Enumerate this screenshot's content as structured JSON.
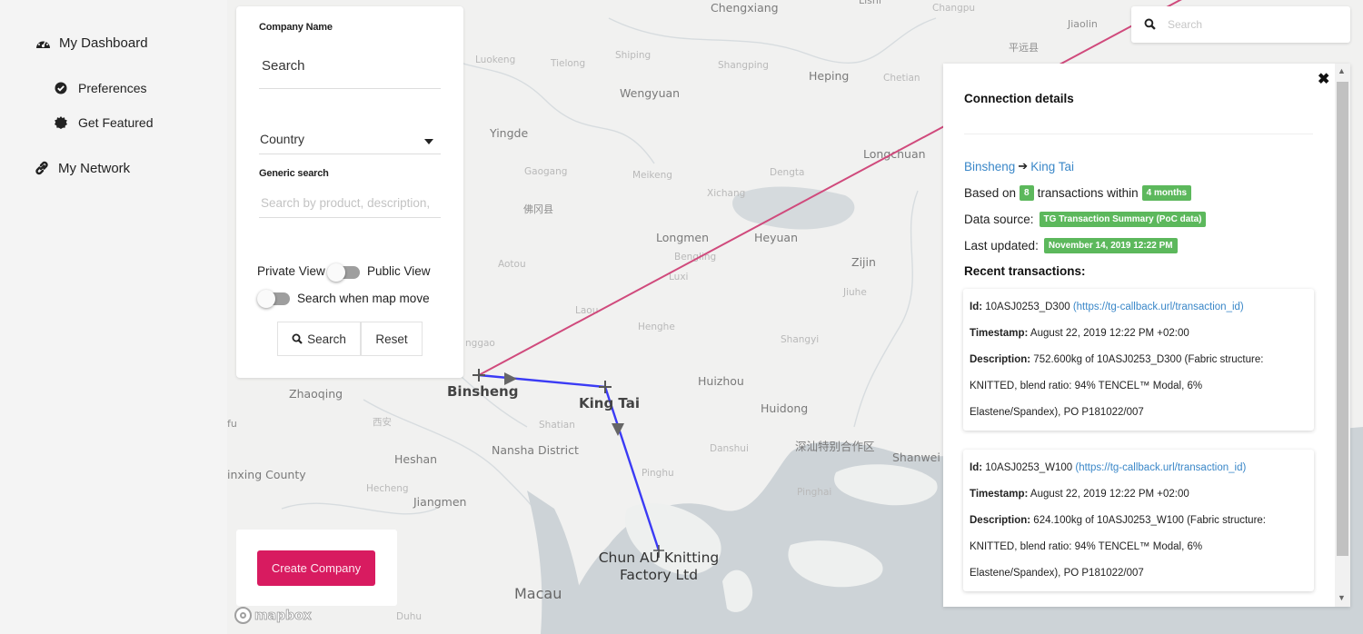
{
  "sidebar": {
    "items": [
      {
        "label": "My Dashboard",
        "icon": "dashboard-icon"
      },
      {
        "label": "Preferences",
        "icon": "check-circle-icon"
      },
      {
        "label": "Get Featured",
        "icon": "certificate-icon"
      },
      {
        "label": "My Network",
        "icon": "link-icon"
      }
    ]
  },
  "search_panel": {
    "company_name_label": "Company Name",
    "company_name_value": "Search",
    "country_value": "Country",
    "generic_search_label": "Generic search",
    "generic_search_placeholder": "Search by product, description,",
    "private_view_label": "Private View",
    "public_view_label": "Public View",
    "search_when_map_move_label": "Search when map move",
    "search_button": "Search",
    "reset_button": "Reset"
  },
  "create_company_button": "Create Company",
  "map": {
    "search_placeholder": "Search",
    "attribution": "mapbox",
    "colors": {
      "route_pink": "#d04a7c",
      "route_blue": "#3b3bf5",
      "water": "#cfd4d8"
    },
    "places": [
      {
        "name": "Chengxiang",
        "cls": "big"
      },
      {
        "name": "Lishi",
        "cls": ""
      },
      {
        "name": "Changpu",
        "cls": "faint"
      },
      {
        "name": "Jiaolin",
        "cls": ""
      },
      {
        "name": "平远县",
        "cls": ""
      },
      {
        "name": "Luokeng",
        "cls": "faint"
      },
      {
        "name": "Tielong",
        "cls": "faint"
      },
      {
        "name": "Shiping",
        "cls": "faint"
      },
      {
        "name": "Shangping",
        "cls": "faint"
      },
      {
        "name": "Heping",
        "cls": "big"
      },
      {
        "name": "Chetian",
        "cls": "faint"
      },
      {
        "name": "Wengyuan",
        "cls": "big"
      },
      {
        "name": "Yingde",
        "cls": "big"
      },
      {
        "name": "Longchuan",
        "cls": "big"
      },
      {
        "name": "Gaogang",
        "cls": "faint"
      },
      {
        "name": "Meikeng",
        "cls": "faint"
      },
      {
        "name": "Dengta",
        "cls": "faint"
      },
      {
        "name": "Xichang",
        "cls": "faint"
      },
      {
        "name": "佛冈县",
        "cls": ""
      },
      {
        "name": "Longmen",
        "cls": "big"
      },
      {
        "name": "Heyuan",
        "cls": "big"
      },
      {
        "name": "Bengling",
        "cls": "faint"
      },
      {
        "name": "Aotou",
        "cls": "faint"
      },
      {
        "name": "Zijin",
        "cls": "big"
      },
      {
        "name": "Luxi",
        "cls": "faint"
      },
      {
        "name": "Jiuhe",
        "cls": "faint"
      },
      {
        "name": "Laou",
        "cls": "faint"
      },
      {
        "name": "Henghe",
        "cls": "faint"
      },
      {
        "name": "Shangyi",
        "cls": "faint"
      },
      {
        "name": "nggao",
        "cls": "faint"
      },
      {
        "name": "Huizhou",
        "cls": "big"
      },
      {
        "name": "Zhaoqing",
        "cls": "big"
      },
      {
        "name": "Huidong",
        "cls": "big"
      },
      {
        "name": "fu",
        "cls": ""
      },
      {
        "name": "西安",
        "cls": "faint"
      },
      {
        "name": "Shatian",
        "cls": "faint"
      },
      {
        "name": "Nansha District",
        "cls": "big"
      },
      {
        "name": "Danshui",
        "cls": "faint"
      },
      {
        "name": "深汕特别合作区",
        "cls": "big"
      },
      {
        "name": "Shanwei",
        "cls": "big"
      },
      {
        "name": "Heshan",
        "cls": "big"
      },
      {
        "name": "inxing County",
        "cls": "big"
      },
      {
        "name": "Pinghu",
        "cls": "faint"
      },
      {
        "name": "Hecheng",
        "cls": "faint"
      },
      {
        "name": "Jiangmen",
        "cls": "big"
      },
      {
        "name": "Pinghai",
        "cls": "faint"
      },
      {
        "name": "Macau",
        "cls": "macau"
      },
      {
        "name": "Duhu",
        "cls": "faint"
      }
    ],
    "nodes": [
      {
        "name": "Binsheng"
      },
      {
        "name": "King Tai"
      },
      {
        "name": "Chun AU Knitting Factory Ltd"
      }
    ]
  },
  "details": {
    "title": "Connection details",
    "from": "Binsheng",
    "arrow": "➔",
    "to": "King Tai",
    "based_on_prefix": "Based on",
    "transaction_count": "8",
    "transactions_within": "transactions within",
    "period": "4 months",
    "data_source_label": "Data source:",
    "data_source": "TG Transaction Summary (PoC data)",
    "last_updated_label": "Last updated:",
    "last_updated": "November 14, 2019 12:22 PM",
    "recent_label": "Recent transactions:",
    "transactions": [
      {
        "id_label": "Id:",
        "id": "10ASJ0253_D300",
        "url": "(https://tg-callback.url/transaction_id)",
        "timestamp_label": "Timestamp:",
        "timestamp": "August 22, 2019 12:22 PM +02:00",
        "description_label": "Description:",
        "description_1": "752.600kg of 10ASJ0253_D300 (Fabric structure:",
        "description_2": "KNITTED, blend ratio: 94% TENCEL™ Modal, 6%",
        "description_3": "Elastene/Spandex), PO P181022/007"
      },
      {
        "id_label": "Id:",
        "id": "10ASJ0253_W100",
        "url": "(https://tg-callback.url/transaction_id)",
        "timestamp_label": "Timestamp:",
        "timestamp": "August 22, 2019 12:22 PM +02:00",
        "description_label": "Description:",
        "description_1": "624.100kg of 10ASJ0253_W100 (Fabric structure:",
        "description_2": "KNITTED, blend ratio: 94% TENCEL™ Modal, 6%",
        "description_3": "Elastene/Spandex), PO P181022/007"
      }
    ]
  }
}
